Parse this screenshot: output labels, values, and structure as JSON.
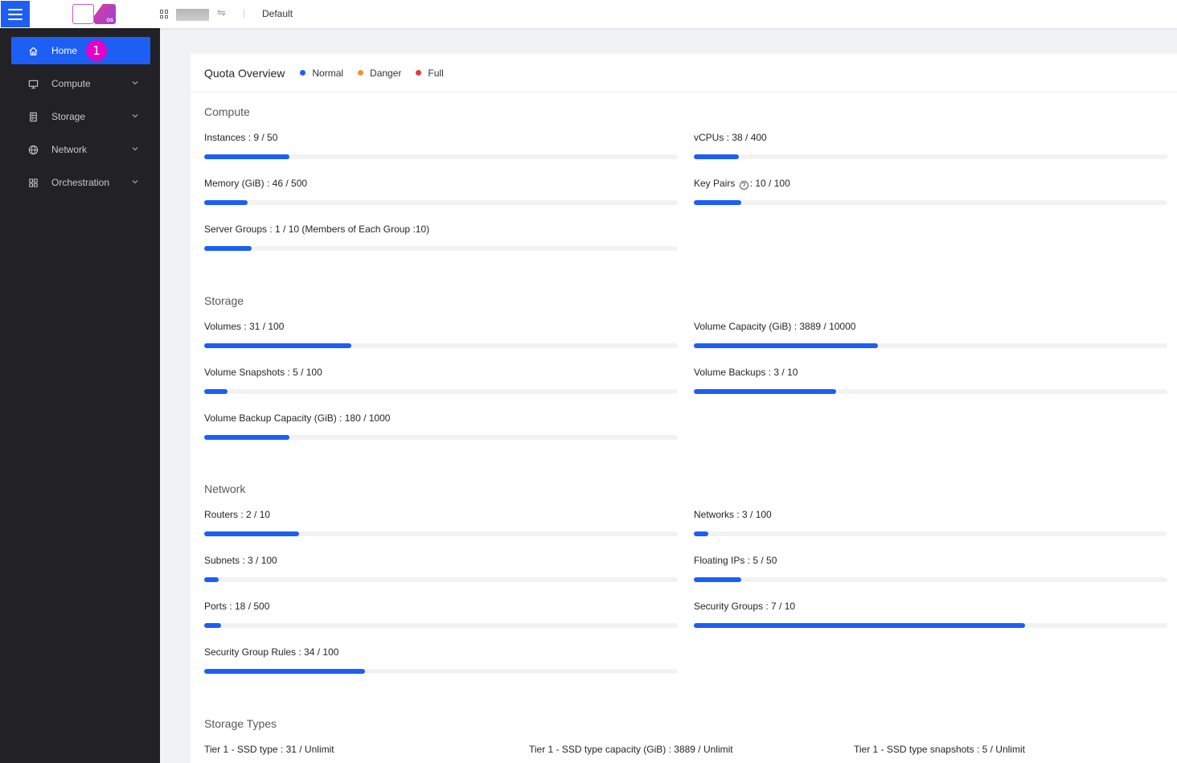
{
  "topbar": {
    "domain": "Default",
    "logo_text": "OS",
    "switch_glyph": "⇋"
  },
  "sidebar": {
    "items": [
      {
        "label": "Home",
        "icon": "home-icon",
        "active": true,
        "badge": "1"
      },
      {
        "label": "Compute",
        "icon": "monitor-icon"
      },
      {
        "label": "Storage",
        "icon": "database-icon"
      },
      {
        "label": "Network",
        "icon": "globe-icon"
      },
      {
        "label": "Orchestration",
        "icon": "grid-icon"
      }
    ]
  },
  "overview": {
    "title": "Quota Overview",
    "legend": [
      {
        "label": "Normal",
        "color": "#1d5ef5"
      },
      {
        "label": "Danger",
        "color": "#f0932b"
      },
      {
        "label": "Full",
        "color": "#e33b3b"
      }
    ]
  },
  "compute": {
    "title": "Compute",
    "instances": {
      "label": "Instances : 9 / 50",
      "used": 9,
      "limit": 50
    },
    "vcpus": {
      "label": "vCPUs : 38 / 400",
      "used": 38,
      "limit": 400
    },
    "memory": {
      "label": "Memory (GiB) : 46 / 500",
      "used": 46,
      "limit": 500
    },
    "key_pairs": {
      "label_a": "Key Pairs",
      "label_b": ": 10 / 100",
      "used": 10,
      "limit": 100,
      "help_glyph": "?"
    },
    "server_groups": {
      "label": "Server Groups : 1 / 10 (Members of Each Group :10)",
      "used": 1,
      "limit": 10
    }
  },
  "storage": {
    "title": "Storage",
    "volumes": {
      "label": "Volumes : 31 / 100",
      "used": 31,
      "limit": 100
    },
    "volume_capacity": {
      "label": "Volume Capacity (GiB) : 3889 / 10000",
      "used": 3889,
      "limit": 10000
    },
    "volume_snapshots": {
      "label": "Volume Snapshots : 5 / 100",
      "used": 5,
      "limit": 100
    },
    "volume_backups": {
      "label": "Volume Backups : 3 / 10",
      "used": 3,
      "limit": 10
    },
    "volume_backup_capacity": {
      "label": "Volume Backup Capacity (GiB) : 180 / 1000",
      "used": 180,
      "limit": 1000
    }
  },
  "network": {
    "title": "Network",
    "routers": {
      "label": "Routers : 2 / 10",
      "used": 2,
      "limit": 10
    },
    "networks": {
      "label": "Networks : 3 / 100",
      "used": 3,
      "limit": 100
    },
    "subnets": {
      "label": "Subnets : 3 / 100",
      "used": 3,
      "limit": 100
    },
    "floating_ips": {
      "label": "Floating IPs : 5 / 50",
      "used": 5,
      "limit": 50
    },
    "ports": {
      "label": "Ports : 18 / 500",
      "used": 18,
      "limit": 500
    },
    "security_groups": {
      "label": "Security Groups : 7 / 10",
      "used": 7,
      "limit": 10
    },
    "security_group_rules": {
      "label": "Security Group Rules : 34 / 100",
      "used": 34,
      "limit": 100
    }
  },
  "storage_types": {
    "title": "Storage Types",
    "items": [
      "Tier 1 - SSD type : 31 / Unlimit",
      "Tier 1 - SSD type capacity (GiB) : 3889 / Unlimit",
      "Tier 1 - SSD type snapshots : 5 / Unlimit"
    ]
  }
}
